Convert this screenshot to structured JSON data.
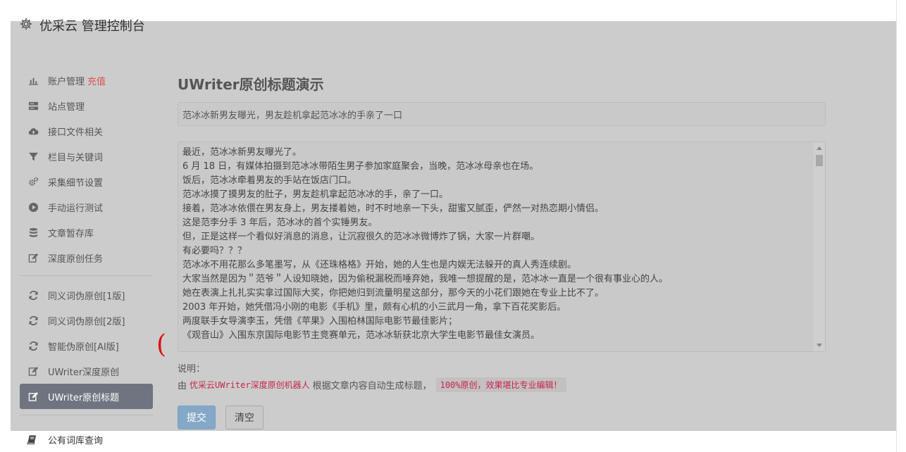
{
  "header": {
    "title": "优采云 管理控制台",
    "icon": "gear-icon"
  },
  "sidebar": {
    "items": [
      {
        "label": "账户管理",
        "icon": "bar-chart-icon",
        "badge": "充值"
      },
      {
        "label": "站点管理",
        "icon": "server-icon"
      },
      {
        "label": "接口文件相关",
        "icon": "cloud-upload-icon"
      },
      {
        "label": "栏目与关键词",
        "icon": "filter-icon"
      },
      {
        "label": "采集细节设置",
        "icon": "gears-icon"
      },
      {
        "label": "手动运行测试",
        "icon": "play-circle-icon"
      },
      {
        "label": "文章暂存库",
        "icon": "database-icon"
      },
      {
        "label": "深度原创任务",
        "icon": "edit-icon"
      },
      {
        "label": "同义词伪原创[1版]",
        "icon": "refresh-icon"
      },
      {
        "label": "同义词伪原创[2版]",
        "icon": "refresh-icon"
      },
      {
        "label": "智能伪原创[AI版]",
        "icon": "refresh-icon"
      },
      {
        "label": "UWriter深度原创",
        "icon": "edit-icon"
      },
      {
        "label": "UWriter原创标题",
        "icon": "edit-icon",
        "active": true
      }
    ],
    "bottom_item": {
      "label": "公有词库查询",
      "icon": "book-icon"
    }
  },
  "main": {
    "title": "UWriter原创标题演示",
    "title_input": "范冰冰新男友曝光，男友趁机拿起范冰冰的手亲了一口",
    "article_lines": [
      "最近，范冰冰新男友曝光了。",
      "6 月 18 日，有媒体拍摄到范冰冰带陌生男子参加家庭聚会，当晚，范冰冰母亲也在场。",
      "饭后，范冰冰牵着男友的手站在饭店门口。",
      "范冰冰摸了摸男友的肚子，男友趁机拿起范冰冰的手，亲了一口。",
      "接着，范冰冰依偎在男友身上，男友搂着她，时不时地亲一下头，甜蜜又腻歪，俨然一对热恋期小情侣。",
      "这是范李分手 3 年后，范冰冰的首个实锤男友。",
      "但，正是这样一个看似好消息的消息，让沉寂很久的范冰冰微博炸了锅，大家一片群嘲。",
      "有必要吗？？？",
      "范冰冰不用花那么多笔墨写，从《还珠格格》开始，她的人生也是内娱无法躲开的真人秀连续剧。",
      "大家当然是因为＂范爷＂人设知晓她，因为偷税漏税而唾弃她，我唯一想提醒的是，范冰冰一直是一个很有事业心的人。",
      "她在表演上扎扎实实拿过国际大奖，你把她归到流量明星这部分，那今天的小花们跟她在专业上比不了。",
      "2003 年开始，她凭借冯小刚的电影《手机》里，颇有心机的小三武月一角，拿下百花奖影后。",
      "两度联手女导演李玉，凭借《苹果》入围柏林国际电影节最佳影片；",
      "《观音山》入围东京国际电影节主竞赛单元，范冰冰斩获北京大学生电影节最佳女演员。"
    ],
    "note_label": "说明：",
    "note_prefix": "由",
    "note_robot": "优采云UWriter深度原创机器人",
    "note_middle": "根据文章内容自动生成标题，",
    "note_highlight": "100%原创，效果堪比专业编辑！",
    "submit_label": "提交",
    "clear_label": "清空",
    "annotation_mark": "("
  },
  "colors": {
    "overlay": "#cccccc",
    "active_nav": "#6f7480",
    "submit": "#85a8c7",
    "accent_red": "#d9534f",
    "code_red": "#c7254e",
    "annotation_red": "#e01010"
  }
}
